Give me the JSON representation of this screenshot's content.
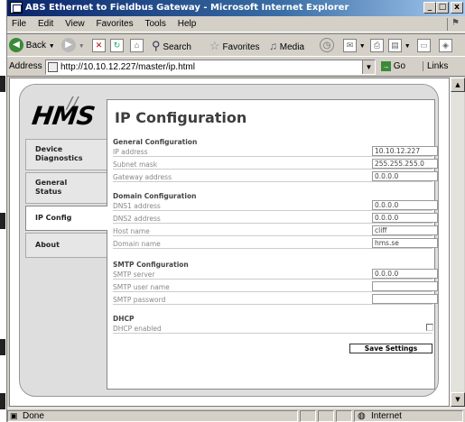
{
  "window": {
    "title": "ABS Ethernet to Fieldbus Gateway - Microsoft Internet Explorer",
    "minimize": "_",
    "maximize": "□",
    "close": "x"
  },
  "menu": [
    "File",
    "Edit",
    "View",
    "Favorites",
    "Tools",
    "Help"
  ],
  "toolbar": {
    "back": "Back",
    "search": "Search",
    "favorites": "Favorites",
    "media": "Media"
  },
  "address": {
    "label": "Address",
    "url": "http://10.10.12.227/master/ip.html",
    "go": "Go",
    "links": "Links"
  },
  "status": {
    "text": "Done",
    "zone": "Internet"
  },
  "page": {
    "logo": "HMS",
    "title": "IP Configuration",
    "nav": [
      {
        "line1": "Device",
        "line2": "Diagnostics"
      },
      {
        "line1": "General",
        "line2": "Status"
      },
      {
        "line1": "IP Config",
        "line2": ""
      },
      {
        "line1": "About",
        "line2": ""
      }
    ],
    "general": {
      "heading": "General Configuration",
      "ip_label": "IP address",
      "ip_value": "10.10.12.227",
      "mask_label": "Subnet mask",
      "mask_value": "255.255.255.0",
      "gw_label": "Gateway address",
      "gw_value": "0.0.0.0"
    },
    "domain": {
      "heading": "Domain Configuration",
      "dns1_label": "DNS1 address",
      "dns1_value": "0.0.0.0",
      "dns2_label": "DNS2 address",
      "dns2_value": "0.0.0.0",
      "host_label": "Host name",
      "host_value": "cliff",
      "domain_label": "Domain name",
      "domain_value": "hms.se"
    },
    "smtp": {
      "heading": "SMTP Configuration",
      "server_label": "SMTP server",
      "server_value": "0.0.0.0",
      "user_label": "SMTP user name",
      "user_value": "",
      "pass_label": "SMTP password",
      "pass_value": ""
    },
    "dhcp": {
      "heading": "DHCP",
      "enabled_label": "DHCP enabled",
      "enabled": false
    },
    "save_label": "Save Settings"
  }
}
